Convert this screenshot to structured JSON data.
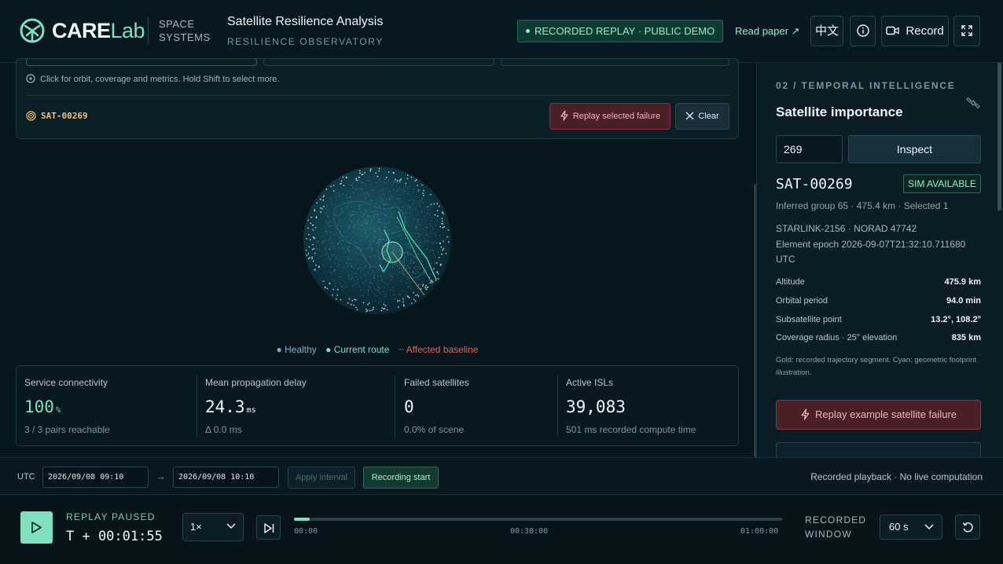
{
  "header": {
    "logo_main": "CARE",
    "logo_accent": "Lab",
    "space_line1": "SPACE",
    "space_line2": "SYSTEMS",
    "title": "Satellite Resilience Analysis",
    "subtitle": "RESILIENCE OBSERVATORY",
    "badge": "RECORDED REPLAY · PUBLIC DEMO",
    "read_paper": "Read paper ↗",
    "lang_button": "中文",
    "record_button": "Record",
    "icons": [
      "logo-icon",
      "info-icon",
      "video-icon",
      "fullscreen-icon"
    ]
  },
  "selection": {
    "hint": "Click for orbit, coverage and metrics. Hold Shift to select more.",
    "selected_sat": "SAT-00269",
    "replay_button": "Replay selected failure",
    "clear_button": "Clear"
  },
  "legend": {
    "healthy": "● Healthy",
    "current_route": "● Current route",
    "affected": "┈ Affected baseline",
    "colors": {
      "healthy": "#6fb5c9",
      "route": "#7fe0c0",
      "affected": "#e0605e"
    }
  },
  "metrics": [
    {
      "label": "Service connectivity",
      "value": "100",
      "unit": "%",
      "sub": "3 / 3 pairs reachable"
    },
    {
      "label": "Mean propagation delay",
      "value": "24.3",
      "unit": "ms",
      "sub": "Δ 0.0 ms"
    },
    {
      "label": "Failed satellites",
      "value": "0",
      "unit": "",
      "sub": "0.0% of scene"
    },
    {
      "label": "Active ISLs",
      "value": "39,083",
      "unit": "",
      "sub": "501 ms recorded compute time"
    }
  ],
  "panel": {
    "kicker": "02 / TEMPORAL INTELLIGENCE",
    "title": "Satellite importance",
    "input_value": "269",
    "inspect_button": "Inspect",
    "sat_name": "SAT-00269",
    "sim_badge": "SIM AVAILABLE",
    "group_line": "Inferred group 65 · 475.4 km · Selected 1",
    "info_line1": "STARLINK-2156 · NORAD 47742",
    "info_line2": "Element epoch 2026-09-07T21:32:10.711680 UTC",
    "rows": [
      {
        "label": "Altitude",
        "value": "475.9 km"
      },
      {
        "label": "Orbital period",
        "value": "94.0 min"
      },
      {
        "label": "Subsatellite point",
        "value": "13.2°, 108.2°"
      },
      {
        "label": "Coverage radius · 25° elevation",
        "value": "835 km"
      }
    ],
    "note": "Gold: recorded trajectory segment. Cyan: geometric footprint illustration.",
    "replay_button": "Replay example satellite failure"
  },
  "timebar": {
    "utc_label": "UTC",
    "start": "2026/09/08 09:10",
    "arrow": "→",
    "end": "2026/09/08 10:10",
    "apply_button": "Apply interval",
    "recording_button": "Recording start",
    "status": "Recorded playback · No live computation"
  },
  "playback": {
    "state": "REPLAY PAUSED",
    "time": "T + 00:01:55",
    "speed": "1×",
    "progress": 0.032,
    "ticks": [
      "00:00",
      "00:30:00",
      "01:00:00"
    ],
    "window_line1": "RECORDED",
    "window_line2": "WINDOW",
    "window_value": "60 s"
  }
}
